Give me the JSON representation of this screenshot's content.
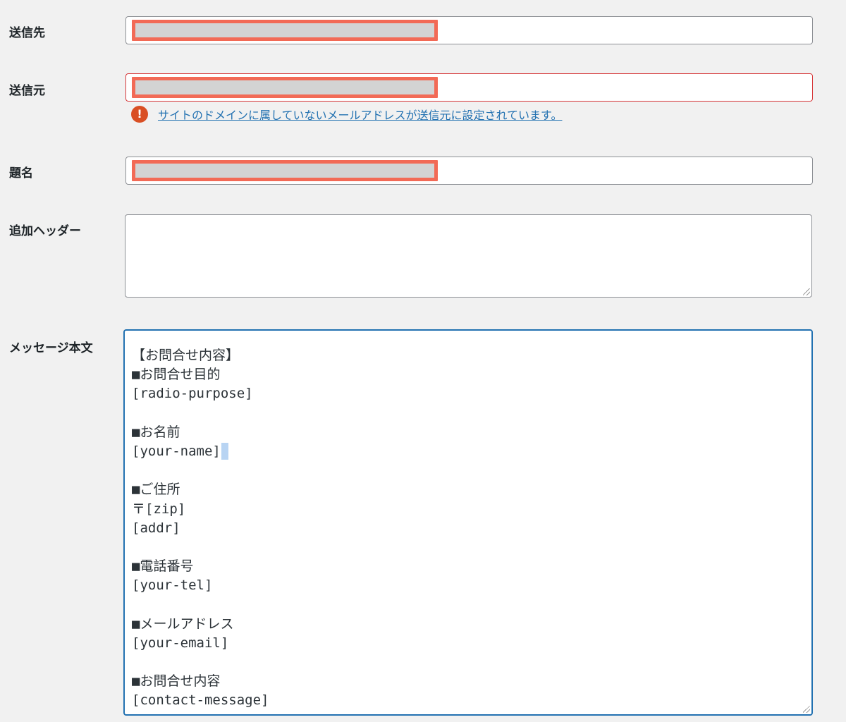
{
  "fields": {
    "to": {
      "label": "送信先"
    },
    "from": {
      "label": "送信元",
      "warning": "サイトのドメインに属していないメールアドレスが送信元に設定されています。"
    },
    "subject": {
      "label": "題名"
    },
    "additional_headers": {
      "label": "追加ヘッダー",
      "value": ""
    },
    "message_body": {
      "label": "メッセージ本文",
      "lines": [
        "【お問合せ内容】",
        "■お問合せ目的",
        "[radio-purpose]",
        "",
        "■お名前",
        "[your-name]",
        "",
        "■ご住所",
        "〒[zip]",
        "[addr]",
        "",
        "■電話番号",
        "[your-tel]",
        "",
        "■メールアドレス",
        "[your-email]",
        "",
        "■お問合せ内容",
        "[contact-message]"
      ]
    }
  },
  "icons": {
    "warning": "exclamation-circle-icon",
    "resize": "resize-grip-icon"
  },
  "colors": {
    "background": "#f1f1f1",
    "error_border": "#d63638",
    "focus_border": "#2271b1",
    "link": "#2271b1",
    "warning_icon": "#d94f24",
    "redaction_border": "#f26a56"
  }
}
